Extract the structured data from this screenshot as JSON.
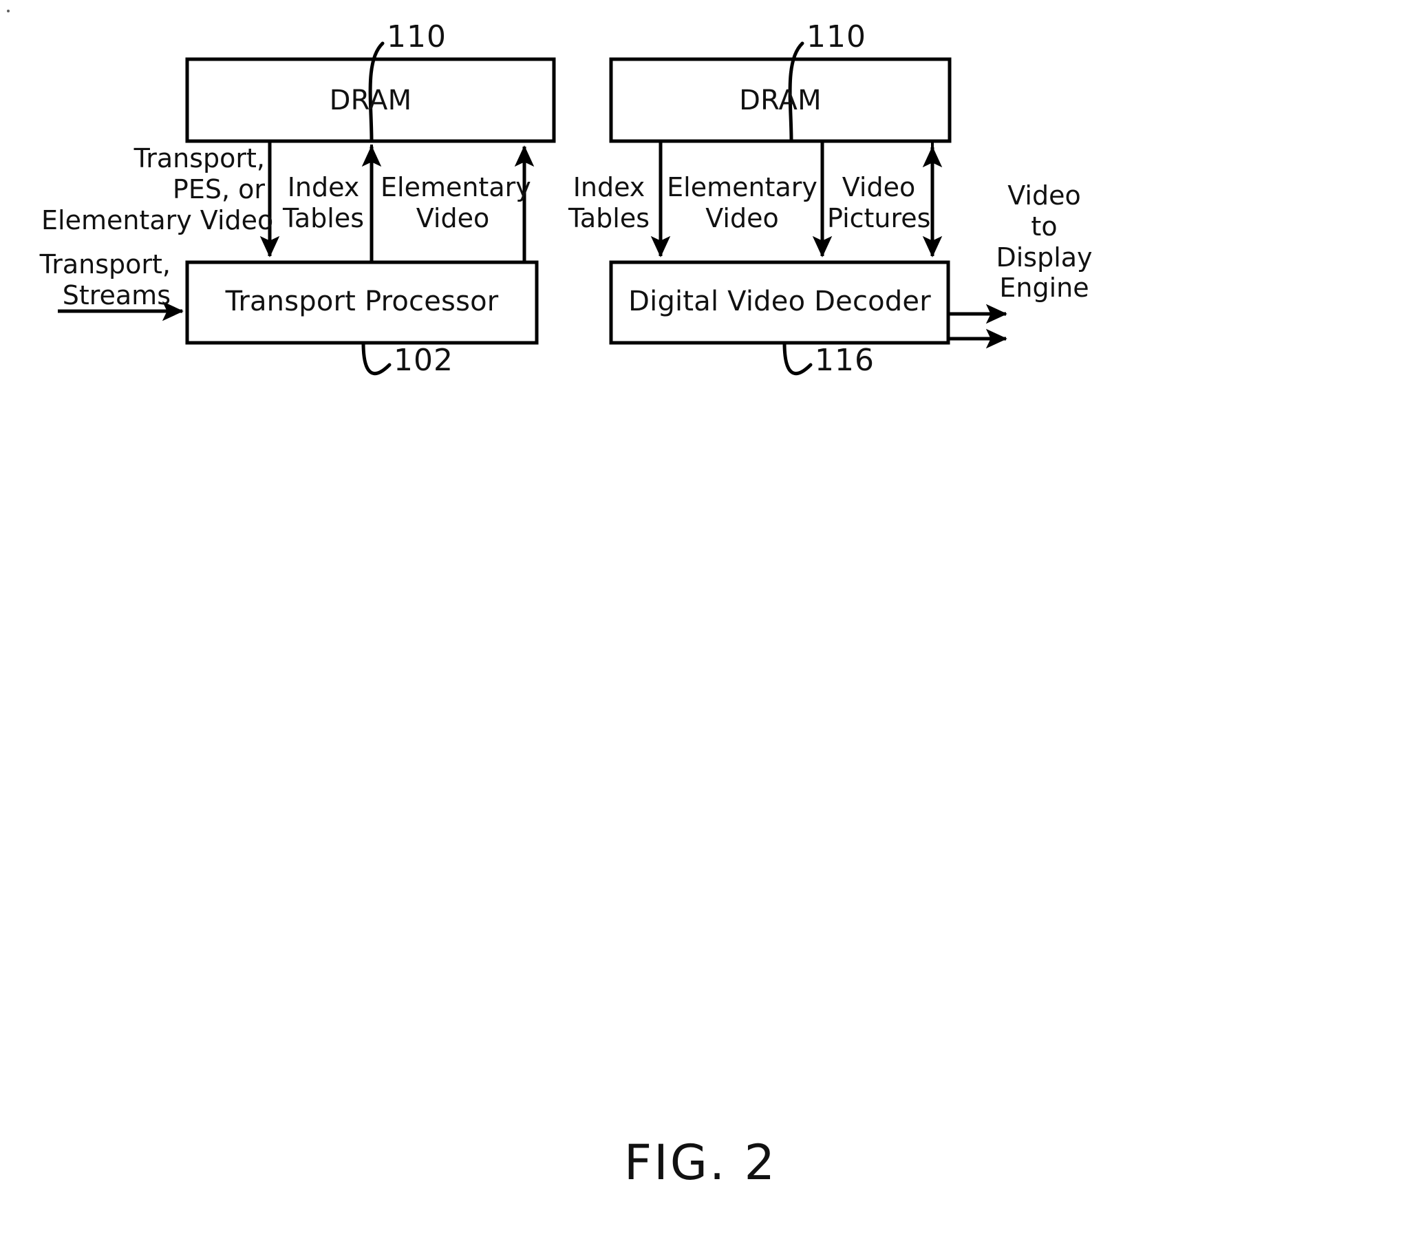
{
  "figure": {
    "caption": "FIG. 2",
    "left_group": {
      "memory_box": {
        "label": "DRAM",
        "ref": "110"
      },
      "processor_box": {
        "label": "Transport Processor",
        "ref": "102"
      },
      "input_label": "Transport,\nStreams",
      "side_label": "Transport,\nPES, or\nElementary Video",
      "flows": [
        {
          "name": "index-tables",
          "label": "Index\nTables",
          "direction": "down"
        },
        {
          "name": "elementary-video",
          "label": "Elementary\nVideo",
          "direction": "up"
        }
      ]
    },
    "right_group": {
      "memory_box": {
        "label": "DRAM",
        "ref": "110"
      },
      "decoder_box": {
        "label": "Digital Video Decoder",
        "ref": "116"
      },
      "output_label": "Video\nto\nDisplay\nEngine",
      "flows": [
        {
          "name": "index-tables",
          "label": "Index\nTables",
          "direction": "down"
        },
        {
          "name": "elementary-video",
          "label": "Elementary\nVideo",
          "direction": "down"
        },
        {
          "name": "video-pictures",
          "label": "Video\nPictures",
          "direction": "both"
        }
      ]
    },
    "colors": {
      "ink": "#000000",
      "paper": "#ffffff"
    }
  }
}
